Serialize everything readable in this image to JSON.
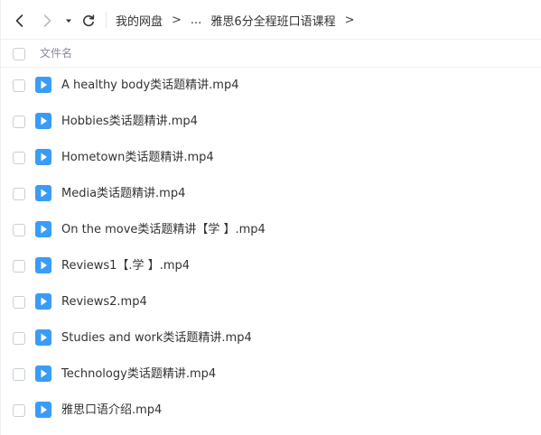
{
  "breadcrumb": {
    "root": "我的网盘",
    "ellipsis": "...",
    "current": "雅思6分全程班口语课程"
  },
  "table": {
    "column_name": "文件名"
  },
  "files": [
    {
      "name": "A healthy body类话题精讲.mp4"
    },
    {
      "name": "Hobbies类话题精讲.mp4"
    },
    {
      "name": "Hometown类话题精讲.mp4"
    },
    {
      "name": "Media类话题精讲.mp4"
    },
    {
      "name": "On the move类话题精讲【学 】.mp4"
    },
    {
      "name": "Reviews1【.学 】.mp4"
    },
    {
      "name": "Reviews2.mp4"
    },
    {
      "name": "Studies and work类话题精讲.mp4"
    },
    {
      "name": "Technology类话题精讲.mp4"
    },
    {
      "name": "雅思口语介绍.mp4"
    }
  ],
  "colors": {
    "video_icon": "#3b9cf5",
    "header_text": "#878c9c"
  },
  "icons": {
    "back": "chevron-left-icon",
    "forward": "chevron-right-icon",
    "dropdown": "caret-down-icon",
    "refresh": "refresh-icon",
    "file": "video-file-icon"
  }
}
